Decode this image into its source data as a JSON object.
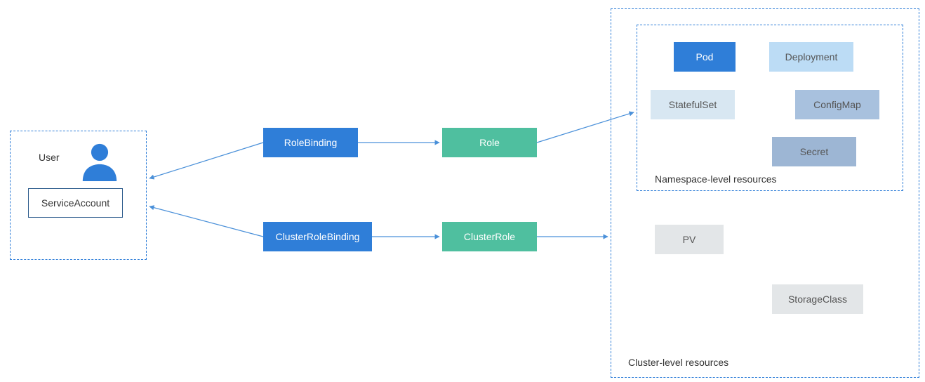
{
  "subjects": {
    "user_label": "User",
    "service_account_label": "ServiceAccount"
  },
  "bindings": {
    "role_binding_label": "RoleBinding",
    "cluster_role_binding_label": "ClusterRoleBinding"
  },
  "roles": {
    "role_label": "Role",
    "cluster_role_label": "ClusterRole"
  },
  "namespace_resources": {
    "title": "Namespace-level resources",
    "pod": "Pod",
    "deployment": "Deployment",
    "statefulset": "StatefulSet",
    "configmap": "ConfigMap",
    "secret": "Secret"
  },
  "cluster_resources": {
    "title": "Cluster-level resources",
    "pv": "PV",
    "storageclass": "StorageClass"
  },
  "colors": {
    "dash": "#2f7ed8",
    "arrow": "#4a90d9",
    "blue": "#2f7ed8",
    "green": "#4fbf9f"
  }
}
